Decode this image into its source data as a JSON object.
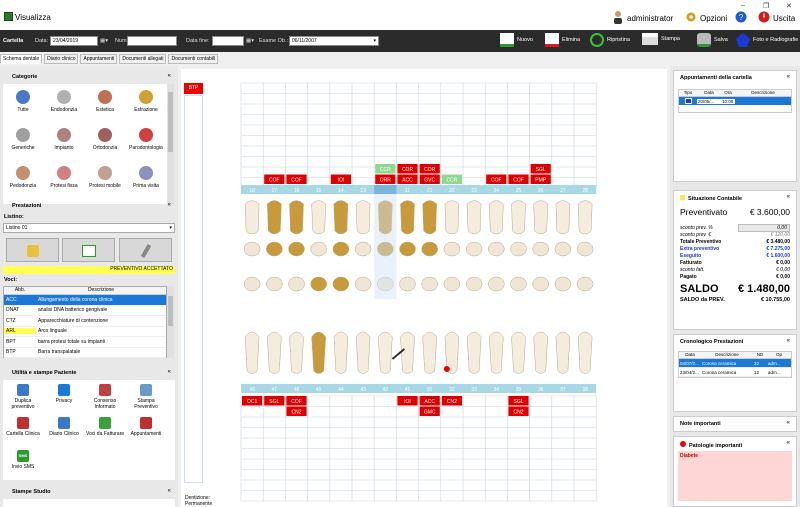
{
  "window": {
    "title": "Visualizza",
    "min": "–",
    "max": "❐",
    "close": "✕"
  },
  "header": {
    "user": "administrator",
    "options": "Opzioni",
    "exit": "Uscita"
  },
  "toolbar": {
    "section": "Cartella",
    "date_label": "Data:",
    "date_value": "23/04/2019",
    "num_label": "Num. Rif.:",
    "num_value": "",
    "end_label": "Data fine:",
    "end_value": "",
    "exam_label": "Esame Ob.:",
    "exam_value": "06/11/2007",
    "buttons": [
      "Nuovo",
      "Elimina",
      "Ripristina",
      "Stampa",
      "Salva",
      "Foto e Radiografie"
    ]
  },
  "tabs": [
    "Schema dentale",
    "Diario clinico",
    "Appuntamenti",
    "Documenti allegati",
    "Documenti contabili"
  ],
  "left": {
    "categorie_title": "Categorie",
    "categorie": [
      "Tutte",
      "Endodonzia",
      "Estetica",
      "Estrazione",
      "Generiche",
      "Impianto",
      "Ortodonzia",
      "Parodontologia",
      "Pedodonzia",
      "Protesi fissa",
      "Protesi mobile",
      "Prima visita"
    ],
    "prestazioni_title": "Prestazioni",
    "listino_label": "Listino:",
    "listino_value": "Listino 01",
    "status_banner": "PREVENTIVO ACCETTATO",
    "voci_label": "Voci:",
    "voci_cols": [
      "Abb.",
      "Descrizione"
    ],
    "voci": [
      [
        "ACC",
        "Allungamento della corona clinica"
      ],
      [
        "DNAT",
        "analisi DNA batterico gengivale"
      ],
      [
        "CTZ",
        "Apparecchiature di contenzione"
      ],
      [
        "ARL",
        "Arco linguale"
      ],
      [
        "BPT",
        "barra protesi totale su impianti"
      ],
      [
        "BTP",
        "Barra transpalatale"
      ]
    ],
    "utilita_title": "Utilità e stampe Paziente",
    "utilita": [
      "Duplica preventivo",
      "Privacy",
      "Consenso Informato",
      "Stampa Preventivo",
      "Cartella Clinica",
      "Diario Clinico",
      "Voci da Fatturare",
      "Appuntamenti",
      "Invio SMS"
    ],
    "stampe_title": "Stampe Studio",
    "sms_badge": "SMS"
  },
  "center": {
    "btp_tag": "BTP",
    "upper_teeth": [
      "18",
      "17",
      "16",
      "15",
      "14",
      "13",
      "12",
      "11",
      "21",
      "22",
      "23",
      "24",
      "25",
      "26",
      "27",
      "28"
    ],
    "lower_teeth": [
      "48",
      "47",
      "46",
      "45",
      "44",
      "43",
      "42",
      "41",
      "31",
      "32",
      "33",
      "34",
      "35",
      "36",
      "37",
      "38"
    ],
    "upper_row3": [
      "",
      "",
      "",
      "",
      "",
      "",
      "CCR",
      "COR",
      "COR",
      "",
      "",
      "",
      "",
      "SGL",
      "",
      ""
    ],
    "upper_row2": [
      "",
      "COF",
      "COF",
      "",
      "IOI",
      "",
      "ORR",
      "ACC",
      "GVC",
      "CCR",
      "",
      "COF",
      "COF",
      "PMP",
      "",
      ""
    ],
    "lower_row1": [
      "OC1",
      "SGL",
      "COF",
      "",
      "",
      "",
      "",
      "IOI",
      "ACC",
      "CN2",
      "",
      "",
      "SGL",
      "",
      "",
      ""
    ],
    "lower_row2": [
      "",
      "",
      "CN2",
      "",
      "",
      "",
      "",
      "",
      "GMC",
      "",
      "",
      "",
      "CN2",
      "",
      "",
      ""
    ],
    "dentition_label": "Dentizione:",
    "dentition_value": "Permanente"
  },
  "right": {
    "appuntamenti_title": "Appuntamenti della cartella",
    "app_cols": [
      "Tipo",
      "Data",
      "Ora",
      "Descrizione"
    ],
    "app_row": [
      "",
      "20/05/...",
      "10:00",
      ""
    ],
    "situazione_title": "Situazione Contabile",
    "preventivato_label": "Preventivato",
    "preventivato_value": "€ 3.600,00",
    "sconto_pct_label": "sconto prev. %",
    "sconto_pct_value": "0,00",
    "sconto_eur_label": "sconto prev. €",
    "sconto_eur_value": "€ 120,00",
    "lines": [
      [
        "Totale Preventivo",
        "€ 3.480,00"
      ],
      [
        "Extra preventivo",
        "€ 7.275,00"
      ],
      [
        "Eseguito",
        "€ 1.600,00"
      ],
      [
        "Fatturato",
        "€ 0,00"
      ],
      [
        "sconto fatt.",
        "€ 0,00"
      ],
      [
        "Pagato",
        "€ 0,00"
      ]
    ],
    "saldo_label": "SALDO",
    "saldo_value": "€ 1.480,00",
    "saldo_prev_label": "SALDO da PREV.",
    "saldo_prev_value": "€ 10.755,00",
    "crono_title": "Cronologico Prestazioni",
    "crono_cols": [
      "Data",
      "Descrizione",
      "ND",
      "Op"
    ],
    "crono_rows": [
      [
        "04/07/2...",
        "Corona ceramica",
        "22",
        "adm..."
      ],
      [
        "23/04/2...",
        "Corona ceramica",
        "12",
        "adm..."
      ]
    ],
    "note_title": "Note importanti",
    "patologie_title": "Patologie importanti",
    "patologie_value": "Diabete"
  }
}
